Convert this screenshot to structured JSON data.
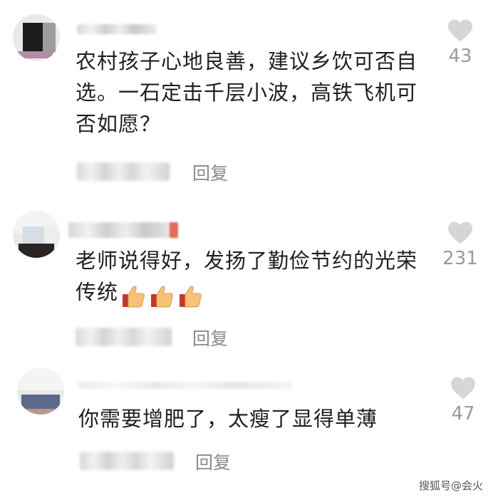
{
  "comments": [
    {
      "text": "农村孩子心地良善，建议乡饮可否自选。一石定击千层小波，高铁飞机可否如愿？",
      "reply_label": "回复",
      "likes": "43"
    },
    {
      "text": "老师说得好，发扬了勤俭节约的光荣传统",
      "reply_label": "回复",
      "likes": "231",
      "emoji": [
        "thumbs-up",
        "thumbs-up",
        "thumbs-up"
      ]
    },
    {
      "text": "你需要增肥了，太瘦了显得单薄",
      "reply_label": "回复",
      "likes": "47"
    }
  ],
  "watermark": "搜狐号@会火",
  "colors": {
    "heart": "#d6d6d6",
    "count": "#9a9a9a",
    "reply": "#8a8a8a"
  },
  "icons": {
    "like": "heart-icon",
    "emoji": "thumbs-up-icon"
  }
}
